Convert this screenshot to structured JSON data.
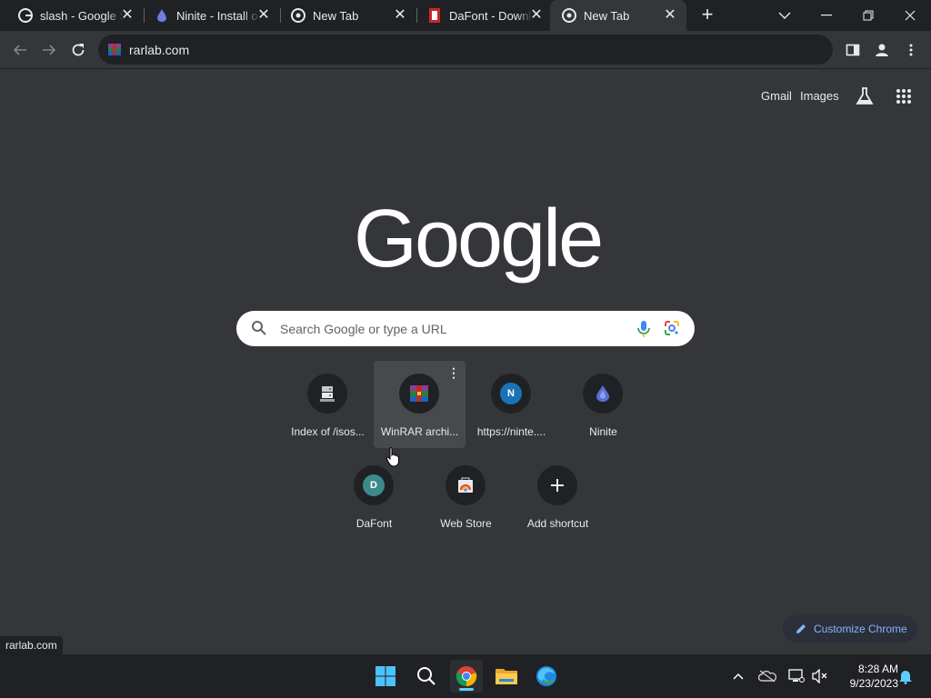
{
  "tabs": [
    {
      "title": "slash - Google S",
      "icon": "google-icon",
      "active": false
    },
    {
      "title": "Ninite - Install o",
      "icon": "ninite-icon",
      "active": false
    },
    {
      "title": "New Tab",
      "icon": "chrome-icon",
      "active": false
    },
    {
      "title": "DaFont - Downl",
      "icon": "dafont-icon",
      "active": false
    },
    {
      "title": "New Tab",
      "icon": "chrome-icon",
      "active": true
    }
  ],
  "omnibox": {
    "url": "rarlab.com",
    "site_icon": "winrar-icon"
  },
  "ntp": {
    "gmail": "Gmail",
    "images": "Images",
    "logo": "Google",
    "search_placeholder": "Search Google or type a URL",
    "shortcuts": [
      {
        "label": "Index of /isos...",
        "icon": "server-icon"
      },
      {
        "label": "WinRAR archi...",
        "icon": "winrar-icon",
        "hovered": true
      },
      {
        "label": "https://ninte....",
        "icon_letter": "N",
        "color": "#1a73b5"
      },
      {
        "label": "Ninite",
        "icon": "ninite-icon"
      },
      {
        "label": "DaFont",
        "icon_letter": "D",
        "color": "#3d8a8a"
      },
      {
        "label": "Web Store",
        "icon": "webstore-icon"
      },
      {
        "label": "Add shortcut",
        "icon": "plus-icon"
      }
    ],
    "customize": "Customize Chrome"
  },
  "status_bubble": "rarlab.com",
  "taskbar": {
    "time": "8:28 AM",
    "date": "9/23/2023"
  },
  "colors": {
    "background": "#35363a",
    "tabstrip": "#202124",
    "accent": "#8ab4f8",
    "taskbar_indicator": "#60cdff"
  }
}
